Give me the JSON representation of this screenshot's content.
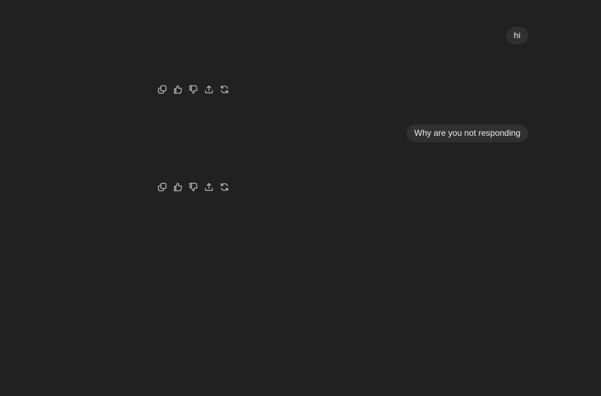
{
  "conversation": {
    "messages": [
      {
        "role": "user",
        "text": "hi"
      },
      {
        "role": "user",
        "text": "Why are you not responding"
      }
    ],
    "response_actions": [
      "copy-icon",
      "thumbs-up-icon",
      "thumbs-down-icon",
      "share-icon",
      "regenerate-icon"
    ]
  },
  "colors": {
    "background": "#212121",
    "bubble": "#303030",
    "text": "#ececec",
    "icon": "#b4b4b4"
  }
}
